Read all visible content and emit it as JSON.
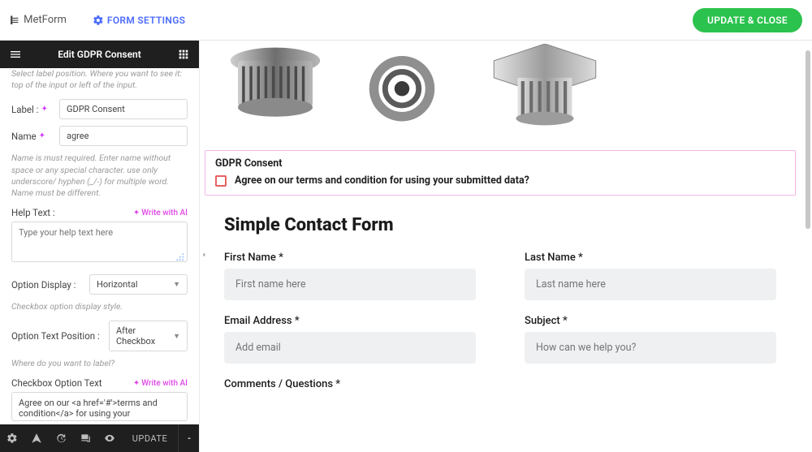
{
  "topbar": {
    "brand": "MetForm",
    "form_settings": "FORM SETTINGS",
    "update_close": "UPDATE & CLOSE"
  },
  "sidebar": {
    "header_title": "Edit GDPR Consent",
    "help_top": "Select label position. Where you want to see it: top of the input or left of the input.",
    "label_lbl": "Label :",
    "label_value": "GDPR Consent",
    "name_lbl": "Name",
    "name_value": "agree",
    "name_help": "Name is must required. Enter name without space or any special character. use only underscore/ hyphen (_/-) for multiple word. Name must be different.",
    "helptext_lbl": "Help Text :",
    "write_with_ai": "Write with AI",
    "helptext_placeholder": "Type your help text here",
    "option_display_lbl": "Option Display :",
    "option_display_value": "Horizontal",
    "option_display_help": "Checkbox option display style.",
    "option_textpos_lbl": "Option Text Position :",
    "option_textpos_value": "After Checkbox",
    "option_textpos_help": "Where do you want to label?",
    "checkbox_option_text_lbl": "Checkbox Option Text",
    "checkbox_option_text_value": "Agree on our <a href='#'>terms and condition</a> for using your",
    "footer_update": "UPDATE"
  },
  "canvas": {
    "gdpr_title": "GDPR Consent",
    "gdpr_question": "Agree on our terms and condition for using your submitted data?",
    "contact_heading": "Simple Contact Form",
    "first_name_lbl": "First Name *",
    "first_name_ph": "First name here",
    "last_name_lbl": "Last Name *",
    "last_name_ph": "Last name here",
    "email_lbl": "Email Address *",
    "email_ph": "Add email",
    "subject_lbl": "Subject *",
    "subject_ph": "How can we help you?",
    "comments_lbl": "Comments / Questions *"
  }
}
